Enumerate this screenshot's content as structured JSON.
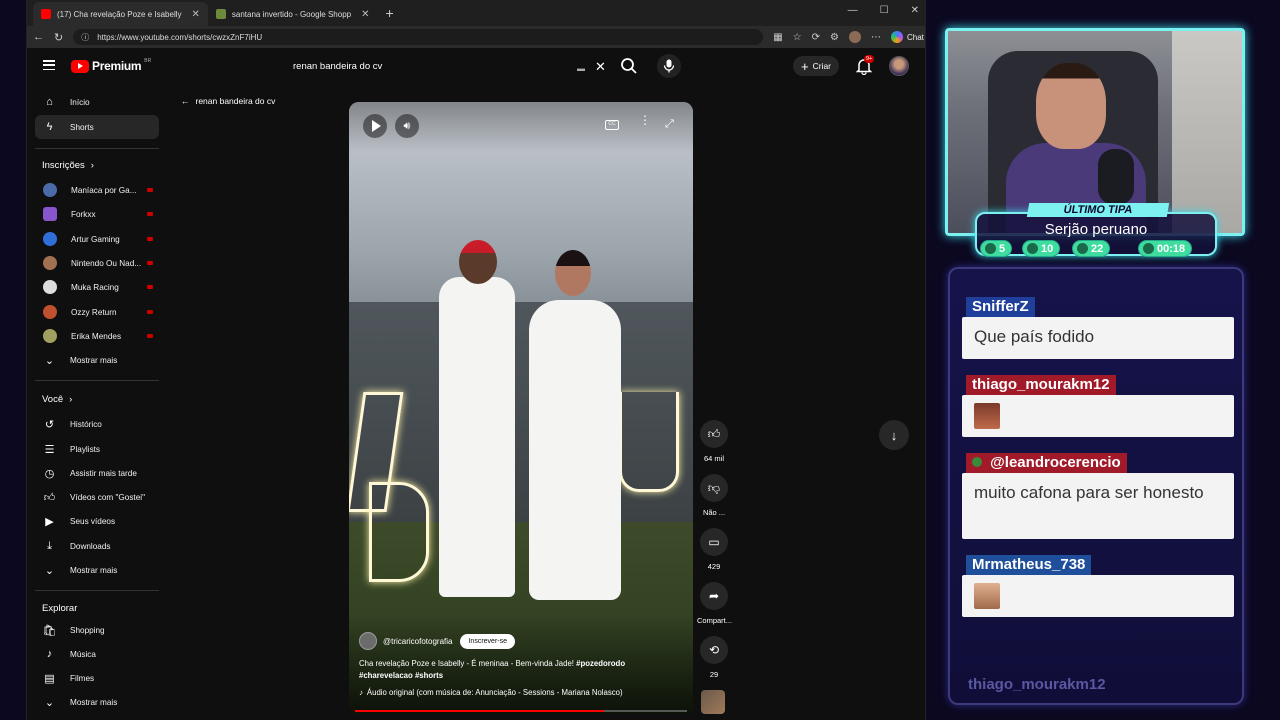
{
  "browser": {
    "tabs": [
      {
        "title": "(17) Cha revelação Poze e Isabelly",
        "active": true
      },
      {
        "title": "santana invertido - Google Shopp",
        "active": false
      }
    ],
    "url": "https://www.youtube.com/shorts/cwzxZnF7iHU",
    "chat_label": "Chat",
    "window_controls": [
      "—",
      "☐",
      "✕"
    ]
  },
  "youtube": {
    "brand": "Premium",
    "region": "BR",
    "search_value": "renan bandeira do cv",
    "create_label": "Criar",
    "notif_count": "9+",
    "back_label": "renan bandeira do cv",
    "sidebar": {
      "primary": [
        {
          "label": "Início",
          "icon": "home-icon"
        },
        {
          "label": "Shorts",
          "icon": "shorts-icon",
          "active": true
        }
      ],
      "subscriptions_heading": "Inscrições",
      "subscriptions": [
        {
          "label": "Maníaca por Ga...",
          "color": "#4a6aa8"
        },
        {
          "label": "Forkxx",
          "color": "#8855cc"
        },
        {
          "label": "Artur Gaming",
          "color": "#2f6fd8"
        },
        {
          "label": "Nintendo Ou Nad...",
          "color": "#a07050"
        },
        {
          "label": "Muka Racing",
          "color": "#dddddd"
        },
        {
          "label": "Ozzy Return",
          "color": "#c05030"
        },
        {
          "label": "Erika Mendes",
          "color": "#a0a060"
        }
      ],
      "subs_more": "Mostrar mais",
      "you_heading": "Você",
      "you_items": [
        {
          "label": "Histórico",
          "icon": "history-icon"
        },
        {
          "label": "Playlists",
          "icon": "playlists-icon"
        },
        {
          "label": "Assistir mais tarde",
          "icon": "watch-later-icon"
        },
        {
          "label": "Vídeos com \"Gostei\"",
          "icon": "liked-icon"
        },
        {
          "label": "Seus vídeos",
          "icon": "your-videos-icon"
        },
        {
          "label": "Downloads",
          "icon": "download-icon"
        }
      ],
      "you_more": "Mostrar mais",
      "explore_heading": "Explorar",
      "explore_items": [
        {
          "label": "Shopping",
          "icon": "shopping-icon"
        },
        {
          "label": "Música",
          "icon": "music-icon"
        },
        {
          "label": "Filmes",
          "icon": "movies-icon"
        }
      ],
      "explore_more": "Mostrar mais"
    },
    "short": {
      "channel": "@tricaricofotografia",
      "subscribe_label": "Inscrever-se",
      "title_plain": "Cha revelação Poze  e Isabelly - É meninaa - Bem-vinda Jade!",
      "hashtag1": "#pozedorodo",
      "hashtag2": "#charevelacao",
      "hashtag3": "#shorts",
      "audio": "Áudio original (com música de: Anunciação - Sessions - Mariana Nolasco)",
      "progress": 0.75
    },
    "actions": [
      {
        "icon": "like-icon",
        "label": "64 mil"
      },
      {
        "icon": "dislike-icon",
        "label": "Não ..."
      },
      {
        "icon": "comment-icon",
        "label": "429"
      },
      {
        "icon": "share-icon",
        "label": "Compart..."
      },
      {
        "icon": "remix-icon",
        "label": "29"
      }
    ]
  },
  "overlay": {
    "last_tipa_label": "ÚLTIMO TIPA",
    "last_tipa_name": "Serjão peruano",
    "stats": [
      "5",
      "10",
      "22",
      "00:18"
    ],
    "accent": "#7df0f0",
    "chat": [
      {
        "user": "SnifferZ",
        "user_color": "#1f3f9a",
        "message": "Que país fodido"
      },
      {
        "user": "thiago_mourakm12",
        "user_color": "#a01a2a",
        "message": ""
      },
      {
        "user": "@leandrocerencio",
        "user_color": "#a01a2a",
        "message": "muito cafona para ser honesto"
      },
      {
        "user": "Mrmatheus_738",
        "user_color": "#1f4f9a",
        "message": ""
      }
    ],
    "chat_fade_user": "thiago_mourakm12"
  }
}
